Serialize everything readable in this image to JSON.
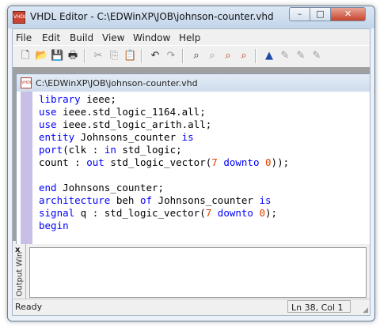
{
  "window": {
    "title": "VHDL Editor - C:\\EDWinXP\\JOB\\johnson-counter.vhd",
    "icon_text": "VHDL",
    "minimize_glyph": "–",
    "maximize_glyph": "□",
    "close_glyph": "✕"
  },
  "menu": {
    "file": "File",
    "edit": "Edit",
    "build": "Build",
    "view": "View",
    "window": "Window",
    "help": "Help"
  },
  "toolbar": {
    "icons": [
      "new-file-icon",
      "open-folder-icon",
      "save-icon",
      "print-icon",
      "cut-icon",
      "copy-icon",
      "paste-icon",
      "undo-icon",
      "redo-icon",
      "find-icon",
      "replace-icon",
      "find-next-icon",
      "find-prev-icon",
      "compile-icon",
      "tool2-icon",
      "tool3-icon",
      "tool4-icon"
    ]
  },
  "document": {
    "title": "C:\\EDWinXP\\JOB\\johnson-counter.vhd",
    "icon_text": "VHDL"
  },
  "code": {
    "l1_kw": "library",
    "l1_rest": " ieee;",
    "l2_kw": "use",
    "l2_rest": " ieee.std_logic_1164.all;",
    "l3_kw": "use",
    "l3_rest": " ieee.std_logic_arith.all;",
    "l4_kw": "entity",
    "l4_mid": " Johnsons_counter ",
    "l4_kw2": "is",
    "l5_kw": "port",
    "l5_mid": "(clk : ",
    "l5_kw2": "in",
    "l5_rest": " std_logic;",
    "l6_a": "count : ",
    "l6_kw": "out",
    "l6_b": " std_logic_vector(",
    "l6_n1": "7",
    "l6_sp": " ",
    "l6_kw2": "downto",
    "l6_sp2": " ",
    "l6_n2": "0",
    "l6_c": "));",
    "l8_kw": "end",
    "l8_rest": " Johnsons_counter;",
    "l9_kw": "architecture",
    "l9_mid": " beh ",
    "l9_kw2": "of",
    "l9_mid2": " Johnsons_counter ",
    "l9_kw3": "is",
    "l10_kw": "signal",
    "l10_a": " q : std_logic_vector(",
    "l10_n1": "7",
    "l10_sp": " ",
    "l10_kw2": "downto",
    "l10_sp2": " ",
    "l10_n2": "0",
    "l10_c": ");",
    "l11_kw": "begin"
  },
  "output": {
    "label": "Output Win",
    "close_glyph": "x"
  },
  "status": {
    "left": "Ready",
    "position": "Ln 38, Col 1"
  }
}
